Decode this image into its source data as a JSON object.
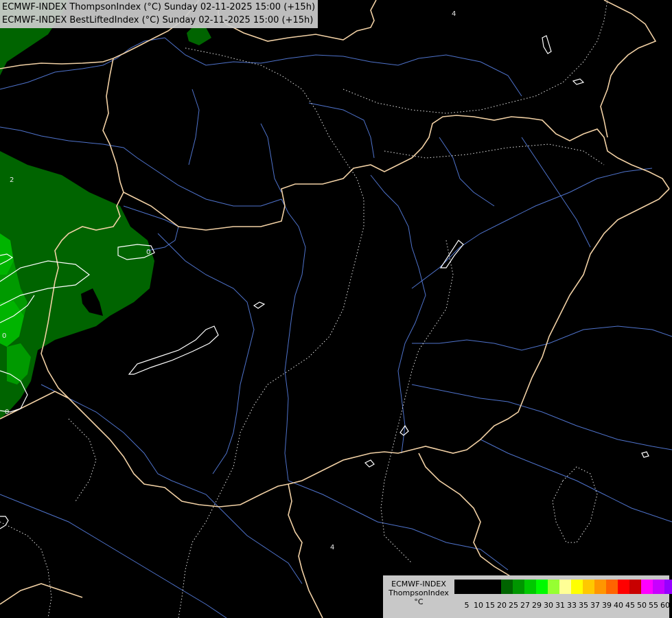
{
  "title": {
    "line1": "ECMWF-INDEX ThompsonIndex (°C) Sunday 02-11-2025 15:00 (+15h)",
    "line2": "ECMWF-INDEX BestLiftedIndex (°C) Sunday 02-11-2025 15:00 (+15h)"
  },
  "contour_labels": [
    "4",
    "2",
    "0",
    "0",
    "4",
    "0"
  ],
  "legend": {
    "model": "ECMWF-INDEX",
    "parameter": "ThompsonIndex",
    "unit": "°C",
    "ticks": [
      "5",
      "10",
      "15",
      "20",
      "25",
      "27",
      "29",
      "30",
      "31",
      "33",
      "35",
      "37",
      "39",
      "40",
      "45",
      "50",
      "55",
      "60"
    ],
    "colors": [
      "#000000",
      "#000000",
      "#000000",
      "#000000",
      "#006400",
      "#009600",
      "#00c800",
      "#00fa00",
      "#96ff32",
      "#ffff96",
      "#ffff00",
      "#ffc800",
      "#ff9600",
      "#ff6400",
      "#ff0000",
      "#c80000",
      "#ff00ff",
      "#c800ff",
      "#9600ff",
      "#6400ff",
      "#0000ff"
    ]
  },
  "colors": {
    "background": "#000000",
    "border": "#f5d5a8",
    "river": "#5a7fd8",
    "contour": "#ffffff",
    "green_dark": "#006400",
    "green_mid": "#008c00",
    "green_light": "#00b400"
  }
}
